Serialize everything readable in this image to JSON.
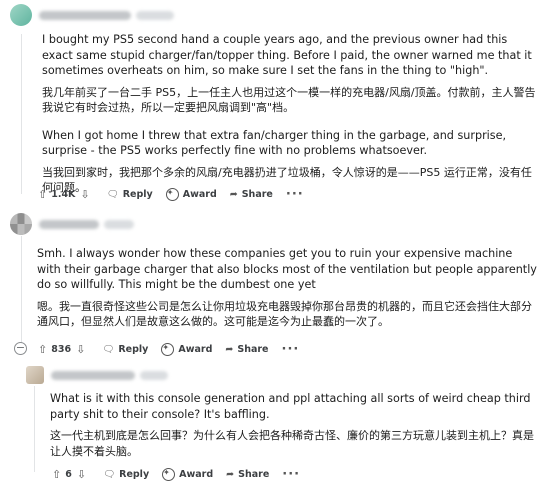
{
  "comments": [
    {
      "paragraphs": [
        "I bought my PS5 second hand a couple years ago, and the previous owner had this exact same stupid charger/fan/topper thing. Before I paid, the owner warned me that it sometimes overheats on him, so make sure I set the fans in the thing to \"high\".",
        "我几年前买了一台二手 PS5，上一任主人也用过这个一模一样的充电器/风扇/顶盖。付款前，主人警告我说它有时会过热，所以一定要把风扇调到\"高\"档。",
        "When I got home I threw that extra fan/charger thing in the garbage, and surprise, surprise - the PS5 works perfectly fine with no problems whatsoever.",
        "当我回到家时，我把那个多余的风扇/充电器扔进了垃圾桶，令人惊讶的是——PS5 运行正常，没有任何问题。"
      ],
      "votes": "1.4K",
      "reply": "Reply",
      "award": "Award",
      "share": "Share"
    },
    {
      "paragraphs": [
        "Smh. I always wonder how these companies get you to ruin your expensive machine with their garbage charger that also blocks most of the ventilation but people apparently do so willfully. This might be the dumbest one yet",
        "嗯。我一直很奇怪这些公司是怎么让你用垃圾充电器毁掉你那台昂贵的机器的，而且它还会挡住大部分通风口，但显然人们是故意这么做的。这可能是迄今为止最蠢的一次了。"
      ],
      "votes": "836",
      "reply": "Reply",
      "award": "Award",
      "share": "Share"
    },
    {
      "paragraphs": [
        "What is it with this console generation and ppl attaching all sorts of weird cheap third party shit to their console? It's baffling.",
        "这一代主机到底是怎么回事？为什么有人会把各种稀奇古怪、廉价的第三方玩意儿装到主机上？真是让人摸不着头脑。"
      ],
      "votes": "6",
      "reply": "Reply",
      "award": "Award",
      "share": "Share"
    }
  ],
  "icons": {
    "upvote": "up-arrow-icon",
    "downvote": "down-arrow-icon",
    "reply": "speech-bubble-icon",
    "award": "award-ribbon-icon",
    "share": "share-arrow-icon",
    "more": "ellipsis-icon",
    "collapse": "collapse-minus-icon"
  },
  "colors": {
    "thread_line": "#e2e4e6",
    "text": "#1c1c1c",
    "meta": "#3c3f42"
  }
}
